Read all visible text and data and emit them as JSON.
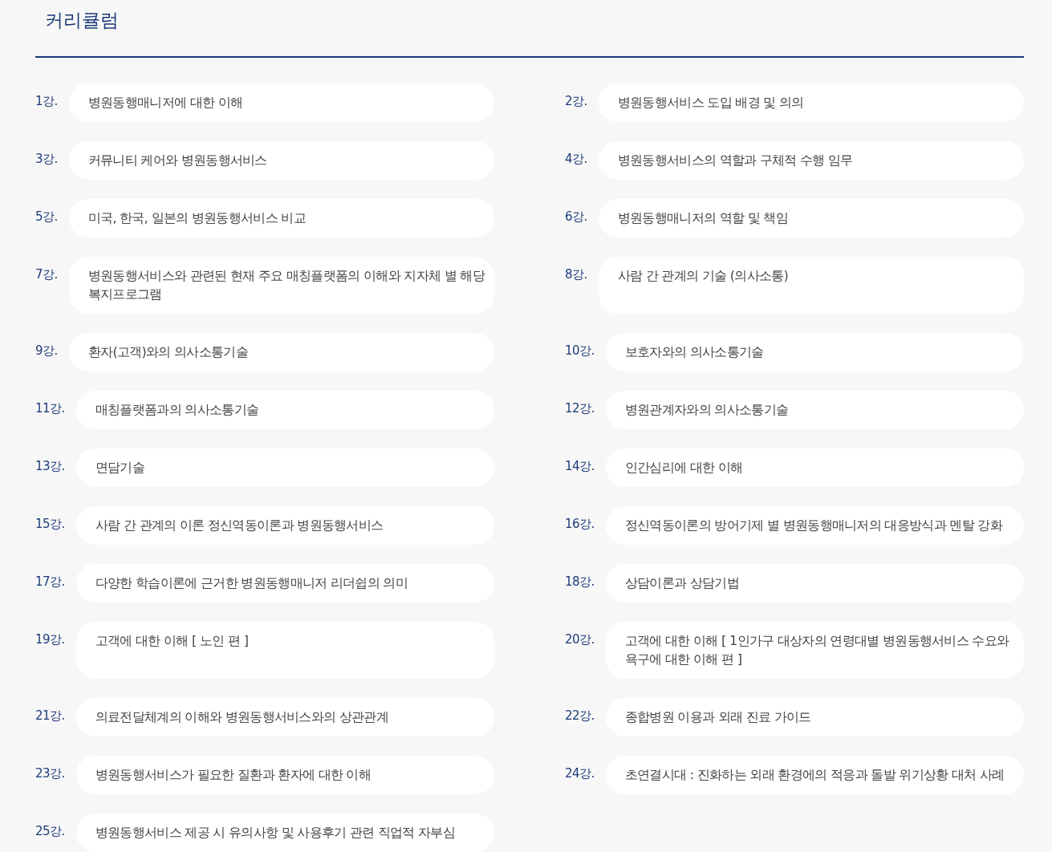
{
  "title": "커리큘럼",
  "lectures": [
    {
      "number": "1강.",
      "title": "병원동행매니저에 대한 이해"
    },
    {
      "number": "2강.",
      "title": "병원동행서비스 도입 배경 및 의의"
    },
    {
      "number": "3강.",
      "title": "커뮤니티 케어와 병원동행서비스"
    },
    {
      "number": "4강.",
      "title": "병원동행서비스의 역할과 구체적 수행 임무"
    },
    {
      "number": "5강.",
      "title": "미국, 한국, 일본의 병원동행서비스 비교"
    },
    {
      "number": "6강.",
      "title": "병원동행매니저의 역할 및 책임"
    },
    {
      "number": "7강.",
      "title": "병원동행서비스와 관련된 현재 주요 매칭플랫폼의 이해와 지자체 별 해당 복지프로그램"
    },
    {
      "number": "8강.",
      "title": "사람 간 관계의 기술 (의사소통)"
    },
    {
      "number": "9강.",
      "title": "환자(고객)와의 의사소통기술"
    },
    {
      "number": "10강.",
      "title": "보호자와의 의사소통기술"
    },
    {
      "number": "11강.",
      "title": "매칭플랫폼과의 의사소통기술"
    },
    {
      "number": "12강.",
      "title": "병원관계자와의 의사소통기술"
    },
    {
      "number": "13강.",
      "title": "면담기술"
    },
    {
      "number": "14강.",
      "title": "인간심리에 대한 이해"
    },
    {
      "number": "15강.",
      "title": "사람 간 관계의 이론 정신역동이론과 병원동행서비스"
    },
    {
      "number": "16강.",
      "title": "정신역동이론의 방어기제 별 병원동행매니저의 대응방식과 멘탈 강화"
    },
    {
      "number": "17강.",
      "title": "다양한 학습이론에 근거한 병원동행매니저 리더쉽의 의미"
    },
    {
      "number": "18강.",
      "title": "상담이론과 상담기법"
    },
    {
      "number": "19강.",
      "title": "고객에 대한 이해 [ 노인 편 ]"
    },
    {
      "number": "20강.",
      "title": "고객에 대한 이해 [ 1인가구 대상자의 연령대별 병원동행서비스 수요와 욕구에 대한 이해 편 ]"
    },
    {
      "number": "21강.",
      "title": "의료전달체계의 이해와 병원동행서비스와의 상관관계"
    },
    {
      "number": "22강.",
      "title": "종합병원 이용과 외래 진료 가이드"
    },
    {
      "number": "23강.",
      "title": "병원동행서비스가 필요한 질환과 환자에 대한 이해"
    },
    {
      "number": "24강.",
      "title": "초연결시대 : 진화하는 외래 환경에의 적응과 돌발 위기상황 대처 사례"
    },
    {
      "number": "25강.",
      "title": "병원동행서비스 제공 시 유의사항 및 사용후기 관련 직업적 자부심"
    }
  ]
}
